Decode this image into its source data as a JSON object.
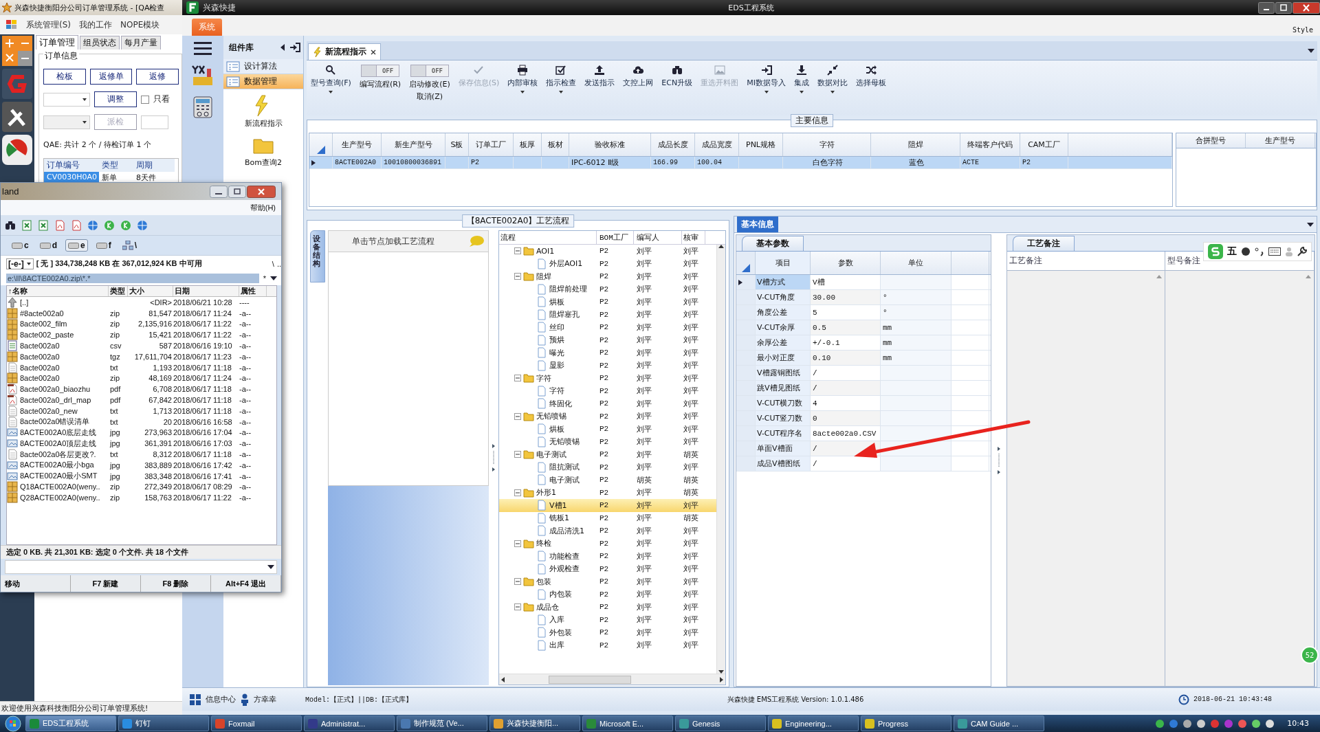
{
  "back_window": {
    "title": "兴森快捷衡阳分公司订单管理系统 - [QA检查",
    "menu": [
      "系统管理(S)",
      "我的工作",
      "NOPE模块"
    ],
    "tabs": [
      {
        "label": "订单管理",
        "selected": true
      },
      {
        "label": "组员状态",
        "selected": false
      },
      {
        "label": "每月产量",
        "selected": false
      }
    ],
    "group_title": "订单信息",
    "buttons": [
      "检板",
      "返修单",
      "返修"
    ],
    "adjust_button": "调整",
    "only_checkbox": {
      "label": "只看",
      "checked": false
    },
    "dispatch_button": {
      "label": "派检",
      "disabled": true
    },
    "summary": "QAE: 共计 2 个 / 待检订单 1 个",
    "grid": {
      "columns": [
        "订单编号",
        "类型",
        "周期"
      ],
      "rows": [
        {
          "cells": [
            "CV0030H0A0",
            "新单",
            "8天件"
          ],
          "selected": true
        }
      ]
    },
    "status": "欢迎使用兴森科技衡阳分公司订单管理系统!"
  },
  "eds_window": {
    "title": "EDS工程系统",
    "app_name": "兴森快捷",
    "system_tab": "系统",
    "style_label": "Style",
    "component_library": {
      "title": "组件库",
      "items": [
        {
          "label": "设计算法",
          "selected": false
        },
        {
          "label": "数据管理",
          "selected": true
        }
      ],
      "tools": [
        "新流程指示",
        "Bom查询2"
      ]
    },
    "doc_tabs": [
      {
        "label": "新流程指示",
        "selected": true
      }
    ],
    "toolbar": [
      {
        "kind": "button",
        "label": "型号查询(F)",
        "disabled": false,
        "dropdown": true
      },
      {
        "kind": "toggle",
        "label": "编写流程(R)",
        "on": false,
        "toggle_text": "OFF"
      },
      {
        "kind": "toggle",
        "label": "启动修改(E)",
        "sublabel": "取消(Z)",
        "on": false,
        "toggle_text": "OFF"
      },
      {
        "kind": "button",
        "label": "保存信息(S)",
        "disabled": true,
        "dropdown": false
      },
      {
        "kind": "button",
        "label": "内部审核",
        "disabled": false,
        "dropdown": true
      },
      {
        "kind": "button",
        "label": "指示检查",
        "disabled": false,
        "dropdown": true
      },
      {
        "kind": "button",
        "label": "发送指示",
        "disabled": false,
        "dropdown": false
      },
      {
        "kind": "button",
        "label": "文控上网",
        "disabled": false,
        "dropdown": false
      },
      {
        "kind": "button",
        "label": "ECN升级",
        "disabled": false,
        "dropdown": false
      },
      {
        "kind": "button",
        "label": "重选开料图",
        "disabled": true,
        "dropdown": false
      },
      {
        "kind": "button",
        "label": "MI数据导入",
        "disabled": false,
        "dropdown": true
      },
      {
        "kind": "button",
        "label": "集成",
        "disabled": false,
        "dropdown": true
      },
      {
        "kind": "button",
        "label": "数据对比",
        "disabled": false,
        "dropdown": true
      },
      {
        "kind": "button",
        "label": "选择母板",
        "disabled": false,
        "dropdown": false
      }
    ],
    "main_info": {
      "title": "主要信息",
      "columns": [
        "生产型号",
        "新生产型号",
        "S板",
        "订单工厂",
        "板厚",
        "板材",
        "验收标准",
        "成品长度",
        "成品宽度",
        "PNL规格",
        "字符",
        "阻焊",
        "终端客户代码",
        "CAM工厂"
      ],
      "rows": [
        {
          "cells": [
            "8ACTE002A0",
            "10010800036891",
            null,
            "P2",
            null,
            null,
            "IPC-6012 Ⅱ级",
            "166.99",
            "100.04",
            null,
            "白色字符",
            "蓝色",
            "ACTE",
            "P2"
          ],
          "selected": true
        }
      ],
      "side_columns": [
        "合拼型号",
        "生产型号"
      ]
    },
    "process": {
      "title": "【8ACTE002A0】工艺流程",
      "side_tab": "设备结构",
      "hint": "单击节点加载工艺流程",
      "columns": [
        "流程",
        "BOM工厂",
        "编写人",
        "核审"
      ],
      "tree": [
        {
          "label": "AOI1",
          "cells": [
            "P2",
            "刘平",
            "刘平"
          ],
          "selected": false,
          "expanded": true,
          "children": [
            {
              "label": "外层AOI1",
              "cells": [
                "P2",
                "刘平",
                "刘平"
              ],
              "selected": false
            }
          ]
        },
        {
          "label": "阻焊",
          "cells": [
            "P2",
            "刘平",
            "刘平"
          ],
          "selected": false,
          "expanded": true,
          "children": [
            {
              "label": "阻焊前处理",
              "cells": [
                "P2",
                "刘平",
                "刘平"
              ],
              "selected": false
            },
            {
              "label": "烘板",
              "cells": [
                "P2",
                "刘平",
                "刘平"
              ],
              "selected": false
            },
            {
              "label": "阻焊塞孔",
              "cells": [
                "P2",
                "刘平",
                "刘平"
              ],
              "selected": false
            },
            {
              "label": "丝印",
              "cells": [
                "P2",
                "刘平",
                "刘平"
              ],
              "selected": false
            },
            {
              "label": "预烘",
              "cells": [
                "P2",
                "刘平",
                "刘平"
              ],
              "selected": false
            },
            {
              "label": "曝光",
              "cells": [
                "P2",
                "刘平",
                "刘平"
              ],
              "selected": false
            },
            {
              "label": "显影",
              "cells": [
                "P2",
                "刘平",
                "刘平"
              ],
              "selected": false
            }
          ]
        },
        {
          "label": "字符",
          "cells": [
            "P2",
            "刘平",
            "刘平"
          ],
          "selected": false,
          "expanded": true,
          "children": [
            {
              "label": "字符",
              "cells": [
                "P2",
                "刘平",
                "刘平"
              ],
              "selected": false
            },
            {
              "label": "终固化",
              "cells": [
                "P2",
                "刘平",
                "刘平"
              ],
              "selected": false
            }
          ]
        },
        {
          "label": "无铅喷锡",
          "cells": [
            "P2",
            "刘平",
            "刘平"
          ],
          "selected": false,
          "expanded": true,
          "children": [
            {
              "label": "烘板",
              "cells": [
                "P2",
                "刘平",
                "刘平"
              ],
              "selected": false
            },
            {
              "label": "无铅喷锡",
              "cells": [
                "P2",
                "刘平",
                "刘平"
              ],
              "selected": false
            }
          ]
        },
        {
          "label": "电子测试",
          "cells": [
            "P2",
            "刘平",
            "胡英"
          ],
          "selected": false,
          "expanded": true,
          "children": [
            {
              "label": "阻抗测试",
              "cells": [
                "P2",
                "刘平",
                "刘平"
              ],
              "selected": false
            },
            {
              "label": "电子测试",
              "cells": [
                "P2",
                "胡英",
                "胡英"
              ],
              "selected": false
            }
          ]
        },
        {
          "label": "外形1",
          "cells": [
            "P2",
            "刘平",
            "胡英"
          ],
          "selected": false,
          "expanded": true,
          "children": [
            {
              "label": "V槽1",
              "cells": [
                "P2",
                "刘平",
                "刘平"
              ],
              "selected": true
            },
            {
              "label": "铣板1",
              "cells": [
                "P2",
                "刘平",
                "胡英"
              ],
              "selected": false
            },
            {
              "label": "成品清洗1",
              "cells": [
                "P2",
                "刘平",
                "刘平"
              ],
              "selected": false
            }
          ]
        },
        {
          "label": "终检",
          "cells": [
            "P2",
            "刘平",
            "刘平"
          ],
          "selected": false,
          "expanded": true,
          "children": [
            {
              "label": "功能检查",
              "cells": [
                "P2",
                "刘平",
                "刘平"
              ],
              "selected": false
            },
            {
              "label": "外观检查",
              "cells": [
                "P2",
                "刘平",
                "刘平"
              ],
              "selected": false
            }
          ]
        },
        {
          "label": "包装",
          "cells": [
            "P2",
            "刘平",
            "刘平"
          ],
          "selected": false,
          "expanded": true,
          "children": [
            {
              "label": "内包装",
              "cells": [
                "P2",
                "刘平",
                "刘平"
              ],
              "selected": false
            }
          ]
        },
        {
          "label": "成品仓",
          "cells": [
            "P2",
            "刘平",
            "刘平"
          ],
          "selected": false,
          "expanded": true,
          "children": [
            {
              "label": "入库",
              "cells": [
                "P2",
                "刘平",
                "刘平"
              ],
              "selected": false
            },
            {
              "label": "外包装",
              "cells": [
                "P2",
                "刘平",
                "刘平"
              ],
              "selected": false
            },
            {
              "label": "出库",
              "cells": [
                "P2",
                "刘平",
                "刘平"
              ],
              "selected": false
            }
          ]
        }
      ]
    },
    "basic_info": {
      "tab": "基本信息",
      "params_tab": "基本参数",
      "columns": [
        "项目",
        "参数",
        "单位"
      ],
      "rows": [
        {
          "item": "V槽方式",
          "value": "V槽",
          "unit": null,
          "current": true
        },
        {
          "item": "V-CUT角度",
          "value": "30.00",
          "unit": "°",
          "current": false
        },
        {
          "item": "角度公差",
          "value": "5",
          "unit": "°",
          "current": false
        },
        {
          "item": "V-CUT余厚",
          "value": "0.5",
          "unit": "mm",
          "current": false
        },
        {
          "item": "余厚公差",
          "value": "+/-0.1",
          "unit": "mm",
          "current": false
        },
        {
          "item": "最小对正度",
          "value": "0.10",
          "unit": "mm",
          "current": false
        },
        {
          "item": "V槽露铜图纸",
          "value": "/",
          "unit": null,
          "current": false
        },
        {
          "item": "跳V槽见图纸",
          "value": "/",
          "unit": null,
          "current": false
        },
        {
          "item": "V-CUT横刀数",
          "value": "4",
          "unit": null,
          "current": false
        },
        {
          "item": "V-CUT竖刀数",
          "value": "0",
          "unit": null,
          "current": false
        },
        {
          "item": "V-CUT程序名",
          "value": "8acte002a0.CSV",
          "unit": null,
          "current": false
        },
        {
          "item": "单面V槽面",
          "value": "/",
          "unit": null,
          "current": false
        },
        {
          "item": "成品V槽图纸",
          "value": "/",
          "unit": null,
          "current": false
        }
      ],
      "remarks_tab": "工艺备注",
      "remarks_columns": [
        "工艺备注",
        "型号备注"
      ]
    },
    "status_bar": {
      "info_center": "信息中心",
      "user": "方幸幸",
      "env": "Model:【正式】||DB:【正式库】",
      "version": "兴森快捷 EMS工程系统 Version: 1.0.1.486",
      "datetime": "2018-06-21 10:43:48"
    }
  },
  "file_manager": {
    "title": "land",
    "menu": [
      "帮助(H)"
    ],
    "drives": [
      {
        "kind": "drive",
        "label": "c",
        "selected": false
      },
      {
        "kind": "drive",
        "label": "d",
        "selected": false
      },
      {
        "kind": "drive",
        "label": "e",
        "selected": true
      },
      {
        "kind": "drive",
        "label": "f",
        "selected": false
      },
      {
        "kind": "network",
        "label": "\\",
        "selected": false
      }
    ],
    "drive_select": "[-e-]",
    "free_space": "[ 无 ]  334,738,248 KB 在 367,012,924 KB 中可用",
    "root_button": "\\",
    "up_button": "..",
    "path": "e:\\II\\8ACTE002A0.zip\\*.*",
    "filter": "*",
    "columns": [
      "↑名称",
      "类型",
      "大小",
      "日期",
      "属性"
    ],
    "files": [
      {
        "kind": "up",
        "name": "[..]",
        "size": "<DIR>",
        "date": "2018/06/21 10:28",
        "attr": "----"
      },
      {
        "kind": "archive",
        "name": "#8acte002a0",
        "type": "zip",
        "size": "81,547",
        "date": "2018/06/17 11:24",
        "attr": "-a--"
      },
      {
        "kind": "archive",
        "name": "8acte002_film",
        "type": "zip",
        "size": "2,135,916",
        "date": "2018/06/17 11:22",
        "attr": "-a--"
      },
      {
        "kind": "archive",
        "name": "8acte002_paste",
        "type": "zip",
        "size": "15,421",
        "date": "2018/06/17 11:22",
        "attr": "-a--"
      },
      {
        "kind": "sheet",
        "name": "8acte002a0",
        "type": "csv",
        "size": "587",
        "date": "2018/06/16 19:10",
        "attr": "-a--"
      },
      {
        "kind": "archive",
        "name": "8acte002a0",
        "type": "tgz",
        "size": "17,611,704",
        "date": "2018/06/17 11:23",
        "attr": "-a--"
      },
      {
        "kind": "text",
        "name": "8acte002a0",
        "type": "txt",
        "size": "1,193",
        "date": "2018/06/17 11:18",
        "attr": "-a--"
      },
      {
        "kind": "archive",
        "name": "8acte002a0",
        "type": "zip",
        "size": "48,169",
        "date": "2018/06/17 11:24",
        "attr": "-a--"
      },
      {
        "kind": "pdf",
        "name": "8acte002a0_biaozhu",
        "type": "pdf",
        "size": "6,708",
        "date": "2018/06/17 11:18",
        "attr": "-a--"
      },
      {
        "kind": "pdf",
        "name": "8acte002a0_drl_map",
        "type": "pdf",
        "size": "67,842",
        "date": "2018/06/17 11:18",
        "attr": "-a--"
      },
      {
        "kind": "text",
        "name": "8acte002a0_new",
        "type": "txt",
        "size": "1,713",
        "date": "2018/06/17 11:18",
        "attr": "-a--"
      },
      {
        "kind": "text",
        "name": "8acte002a0错误清单",
        "type": "txt",
        "size": "20",
        "date": "2018/06/16 16:58",
        "attr": "-a--"
      },
      {
        "kind": "image",
        "name": "8ACTE002A0底层走线",
        "type": "jpg",
        "size": "273,963",
        "date": "2018/06/16 17:04",
        "attr": "-a--"
      },
      {
        "kind": "image",
        "name": "8ACTE002A0顶层走线",
        "type": "jpg",
        "size": "361,391",
        "date": "2018/06/16 17:03",
        "attr": "-a--"
      },
      {
        "kind": "text",
        "name": "8acte002a0各层更改?.",
        "type": "txt",
        "size": "8,312",
        "date": "2018/06/17 11:18",
        "attr": "-a--"
      },
      {
        "kind": "image",
        "name": "8ACTE002A0最小bga",
        "type": "jpg",
        "size": "383,889",
        "date": "2018/06/16 17:42",
        "attr": "-a--"
      },
      {
        "kind": "image",
        "name": "8ACTE002A0最小SMT",
        "type": "jpg",
        "size": "383,348",
        "date": "2018/06/16 17:41",
        "attr": "-a--"
      },
      {
        "kind": "archive",
        "name": "Q18ACTE002A0(weny..",
        "type": "zip",
        "size": "272,349",
        "date": "2018/06/17 08:29",
        "attr": "-a--"
      },
      {
        "kind": "archive",
        "name": "Q28ACTE002A0(weny..",
        "type": "zip",
        "size": "158,763",
        "date": "2018/06/17 11:22",
        "attr": "-a--"
      }
    ],
    "status": "选定 0 KB. 共 21,301 KB: 选定 0 个文件. 共 18 个文件",
    "function_keys": [
      "移动",
      "F7 新建",
      "F8 删除",
      "Alt+F4 退出"
    ]
  },
  "ime_toolbar": {
    "mode": "五"
  },
  "side_badge": "52",
  "taskbar": {
    "items": [
      {
        "label": "EDS工程系统",
        "selected": true
      },
      {
        "label": "钉钉",
        "selected": false
      },
      {
        "label": "Foxmail",
        "selected": false
      },
      {
        "label": "Administrat...",
        "selected": false
      },
      {
        "label": "制作规范 (Ve...",
        "selected": false
      },
      {
        "label": "兴森快捷衡阳...",
        "selected": false
      },
      {
        "label": "Microsoft E...",
        "selected": false
      },
      {
        "label": "Genesis",
        "selected": false
      },
      {
        "label": "Engineering...",
        "selected": false
      },
      {
        "label": "Progress",
        "selected": false
      },
      {
        "label": "CAM Guide ...",
        "selected": false
      }
    ],
    "clock": "10:43"
  }
}
